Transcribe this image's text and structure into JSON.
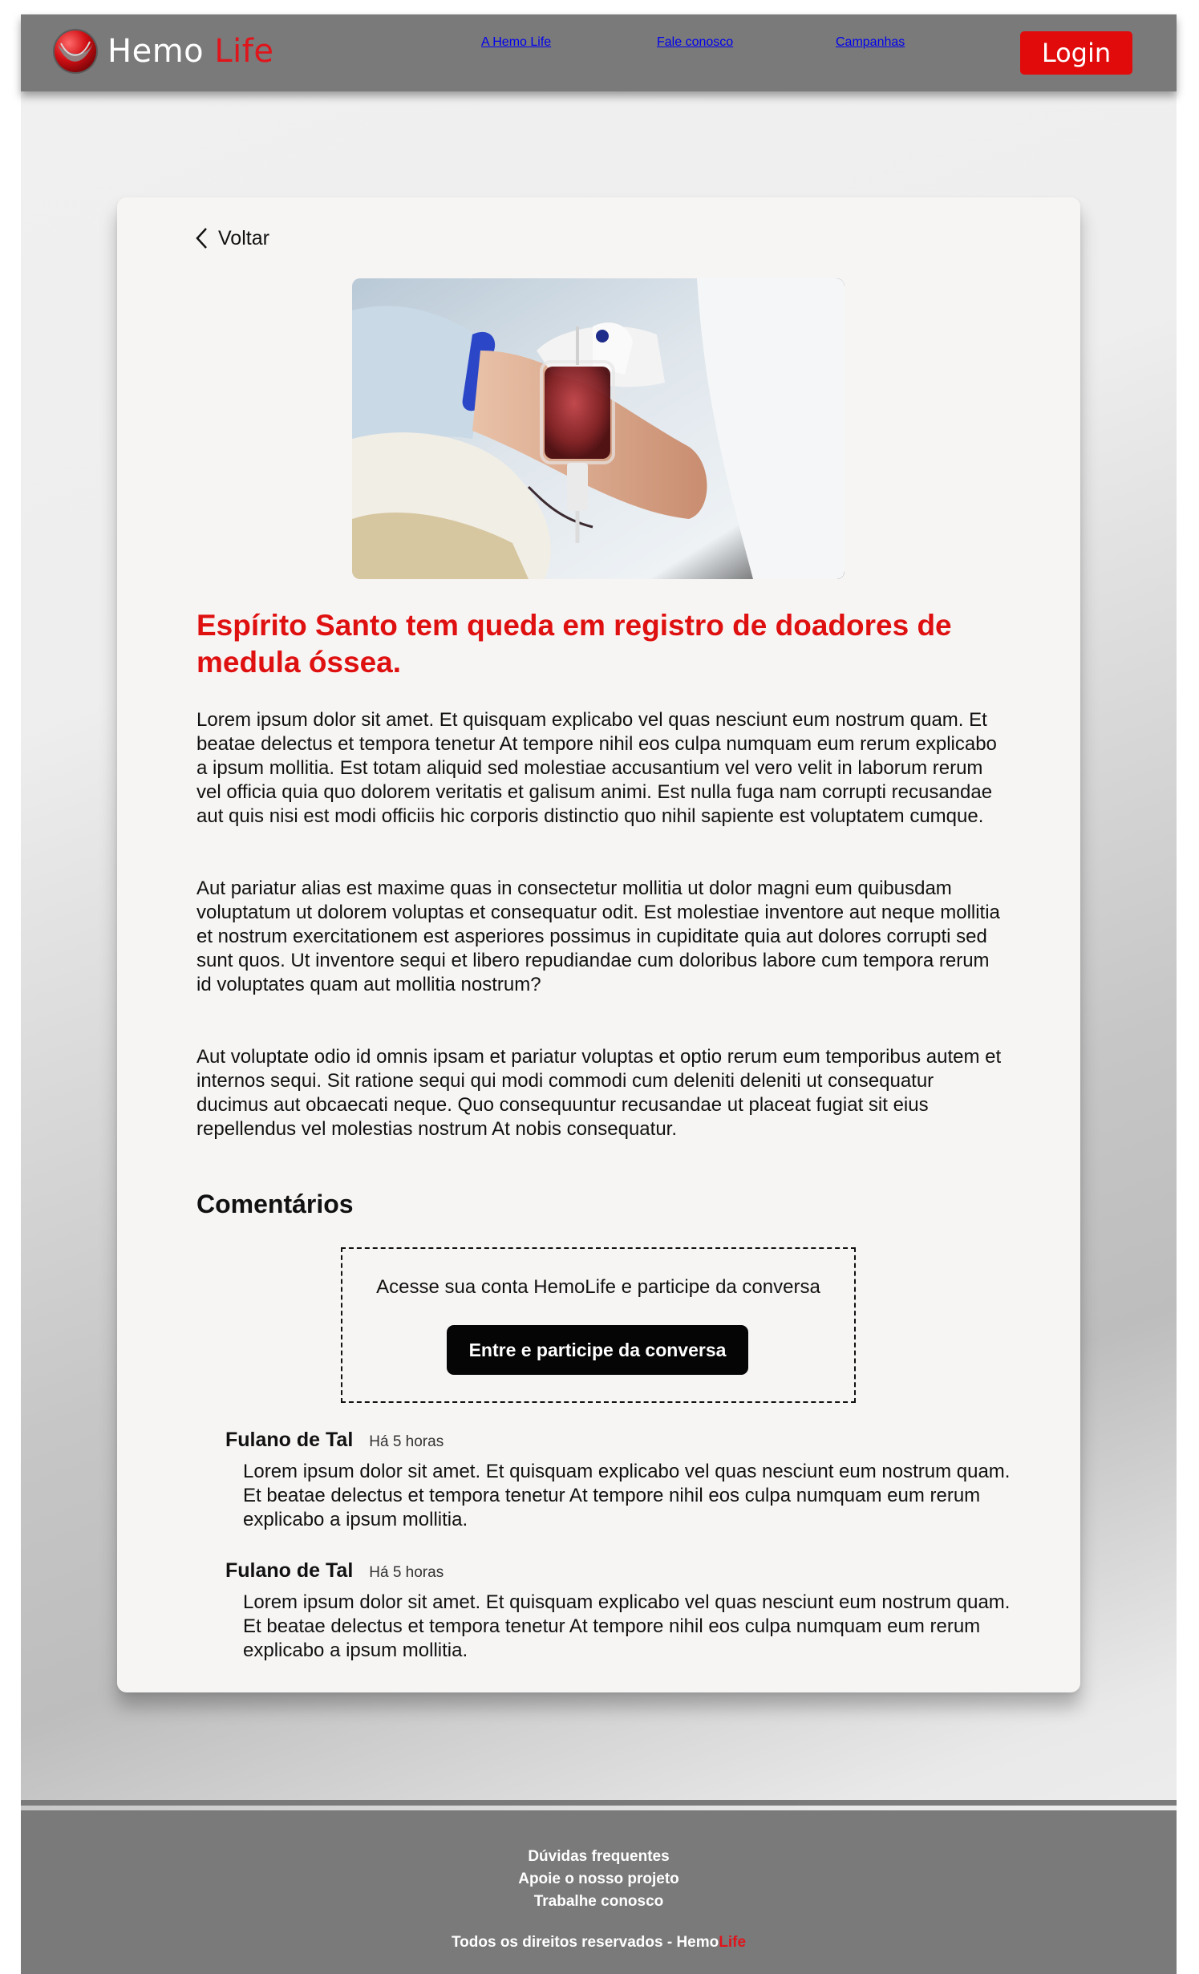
{
  "brand": {
    "name": "Hemo",
    "accent": "Life",
    "accent_color": "#e0141b"
  },
  "nav": {
    "items": [
      "A Hemo Life",
      "Fale conosco",
      "Campanhas"
    ],
    "login_label": "Login"
  },
  "article": {
    "back_label": "Voltar",
    "hero_icon": "blood-bag-photo",
    "title": "Espírito Santo tem queda em registro de doadores de medula óssea.",
    "paragraphs": [
      "Lorem ipsum dolor sit amet. Et quisquam explicabo vel quas nesciunt eum nostrum quam. Et beatae delectus et tempora tenetur At tempore nihil eos culpa numquam eum rerum explicabo a ipsum mollitia. Est totam aliquid sed molestiae accusantium vel vero velit in laborum rerum vel officia quia quo dolorem veritatis et galisum animi. Est nulla fuga nam corrupti recusandae aut quis nisi est modi officiis hic corporis distinctio quo nihil sapiente est voluptatem cumque.",
      "Aut pariatur alias est maxime quas in consectetur mollitia ut dolor magni eum quibusdam voluptatum ut dolorem voluptas et consequatur odit. Est molestiae inventore aut neque mollitia et nostrum exercitationem est asperiores possimus in cupiditate quia aut dolores corrupti sed sunt quos. Ut inventore sequi et libero repudiandae cum doloribus labore cum tempora rerum id voluptates quam aut mollitia nostrum?",
      "Aut voluptate odio id omnis ipsam et pariatur voluptas et optio rerum eum temporibus autem et internos sequi. Sit ratione sequi qui modi commodi cum deleniti deleniti ut consequatur ducimus aut obcaecati neque. Quo consequuntur recusandae ut placeat fugiat sit eius repellendus vel molestias nostrum At nobis consequatur."
    ]
  },
  "comments": {
    "title": "Comentários",
    "login_prompt": "Acesse sua conta HemoLife e participe da conversa",
    "login_cta": "Entre e  participe da conversa",
    "items": [
      {
        "author": "Fulano de Tal",
        "time": "Há 5 horas",
        "text": "Lorem ipsum dolor sit amet. Et quisquam explicabo vel quas nesciunt eum nostrum quam. Et beatae delectus et tempora tenetur At tempore nihil eos culpa numquam eum rerum explicabo a ipsum mollitia."
      },
      {
        "author": "Fulano de Tal",
        "time": "Há 5 horas",
        "text": "Lorem ipsum dolor sit amet. Et quisquam explicabo vel quas nesciunt eum nostrum quam. Et beatae delectus et tempora tenetur At tempore nihil eos culpa numquam eum rerum explicabo a ipsum mollitia."
      }
    ]
  },
  "footer": {
    "links": [
      "Dúvidas frequentes",
      "Apoie o nosso projeto",
      "Trabalhe conosco"
    ],
    "copyright": "Todos os direitos reservados - Hemo",
    "copyright_accent": "Life"
  }
}
